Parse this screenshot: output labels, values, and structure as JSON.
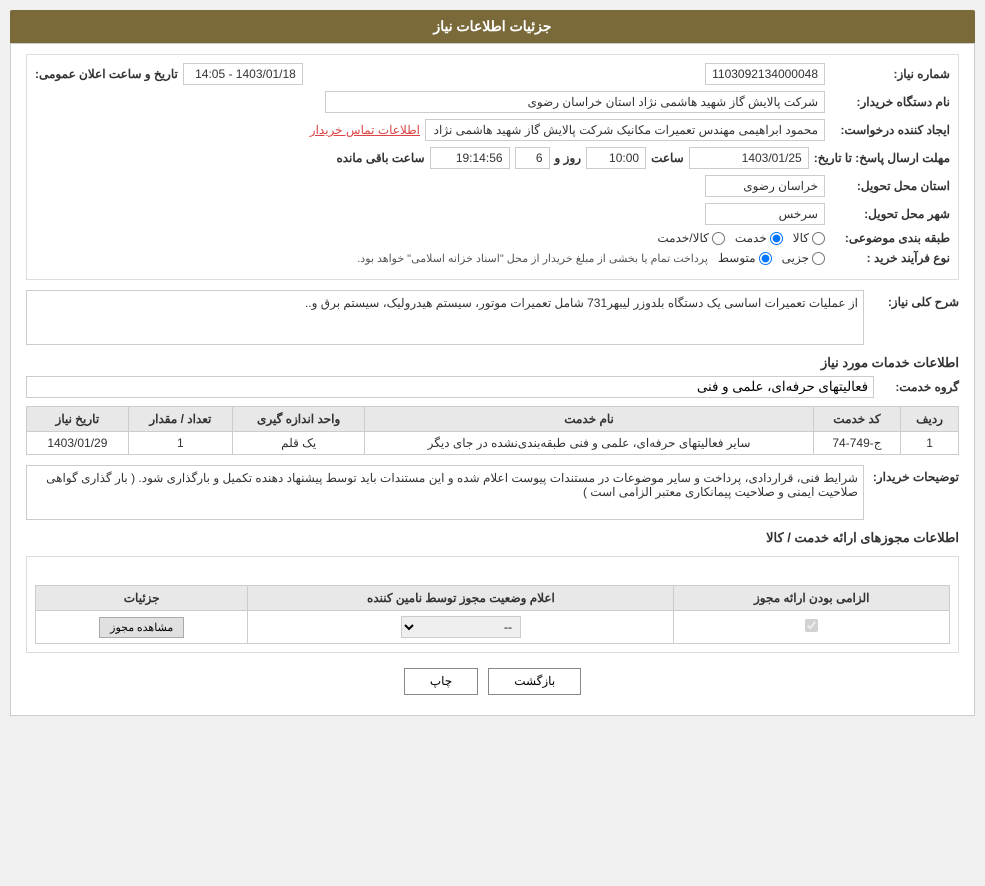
{
  "page": {
    "title": "جزئیات اطلاعات نیاز",
    "fields": {
      "shomareNiaz_label": "شماره نیاز:",
      "shomareNiaz_value": "1103092134000048",
      "namDastgah_label": "نام دستگاه خریدار:",
      "namDastgah_value": "شرکت پالایش گاز شهید هاشمی نژاد   استان خراسان رضوی",
      "ijadKonande_label": "ایجاد کننده درخواست:",
      "ijadKonande_value": "محمود ابراهیمی مهندس تعمیرات مکانیک شرکت پالایش گاز شهید هاشمی نژاد",
      "ijadKonande_link": "اطلاعات تماس خریدار",
      "mohlat_label": "مهلت ارسال پاسخ: تا تاریخ:",
      "mohlat_date": "1403/01/25",
      "mohlat_saat_label": "ساعت",
      "mohlat_saat": "10:00",
      "mohlat_roz_label": "روز و",
      "mohlat_roz": "6",
      "mohlat_mande_label": "ساعت باقی مانده",
      "mohlat_mande": "19:14:56",
      "takhvil_ostan_label": "استان محل تحویل:",
      "takhvil_ostan_value": "خراسان رضوی",
      "takhvil_shahr_label": "شهر محل تحویل:",
      "takhvil_shahr_value": "سرخس",
      "tabaghe_label": "طبقه بندی موضوعی:",
      "tabaghe_kala": "کالا",
      "tabaghe_khadamat": "خدمت",
      "tabaghe_kala_khadamat": "کالا/خدمت",
      "noeFarayand_label": "نوع فرآیند خرید :",
      "noeFarayand_jozee": "جزیی",
      "noeFarayand_motevaset": "متوسط",
      "noeFarayand_desc": "پرداخت تمام یا بخشی از مبلغ خریدار از محل \"اسناد خزانه اسلامی\" خواهد بود.",
      "taarikh_va_saat_label": "تاریخ و ساعت اعلان عمومی:",
      "taarikh_va_saat_value": "1403/01/18 - 14:05"
    },
    "sharh_section": {
      "title": "شرح کلی نیاز:",
      "content": "از عملیات تعمیرات اساسی یک دستگاه بلدوزر  لیبهر731 شامل تعمیرات موتور، سیستم هیدرولیک، سیستم برق و.."
    },
    "khadamat_section": {
      "title": "اطلاعات خدمات مورد نیاز",
      "gorohe_khadamat_label": "گروه خدمت:",
      "gorohe_khadamat_value": "فعالیتهای حرفه‌ای، علمی و فنی",
      "table": {
        "headers": [
          "ردیف",
          "کد خدمت",
          "نام خدمت",
          "واحد اندازه گیری",
          "تعداد / مقدار",
          "تاریخ نیاز"
        ],
        "rows": [
          {
            "radif": "1",
            "kod": "ج-749-74",
            "nam": "سایر فعالیتهای حرفه‌ای، علمی و فنی طبقه‌بندی‌نشده در جای دیگر",
            "vahed": "یک قلم",
            "tedad": "1",
            "tarikh": "1403/01/29"
          }
        ]
      }
    },
    "tosiyeh_section": {
      "title": "توضیحات خریدار:",
      "content": "شرایط فنی، قراردادی، پرداخت و سایر موضوعات در مستندات پیوست اعلام شده و این مستندات باید توسط پیشنهاد دهنده تکمیل و  بارگذاری شود. ( بار گذاری گواهی صلاحیت ایمنی و صلاحیت پیمانکاری معتبر الزامی است )"
    },
    "mojozha_section": {
      "title": "اطلاعات مجوزهای ارائه خدمت / کالا",
      "permit_title": "الزامی بودن ارائه مجوز",
      "permit_table": {
        "headers": [
          "الزامی بودن ارائه مجوز",
          "اعلام وضعیت مجوز توسط نامین کننده",
          "جزئیات"
        ],
        "rows": [
          {
            "elzami": true,
            "vaziat": "--",
            "joziat": "مشاهده مجوز"
          }
        ]
      }
    },
    "buttons": {
      "chap": "چاپ",
      "bazgasht": "بازگشت"
    }
  }
}
